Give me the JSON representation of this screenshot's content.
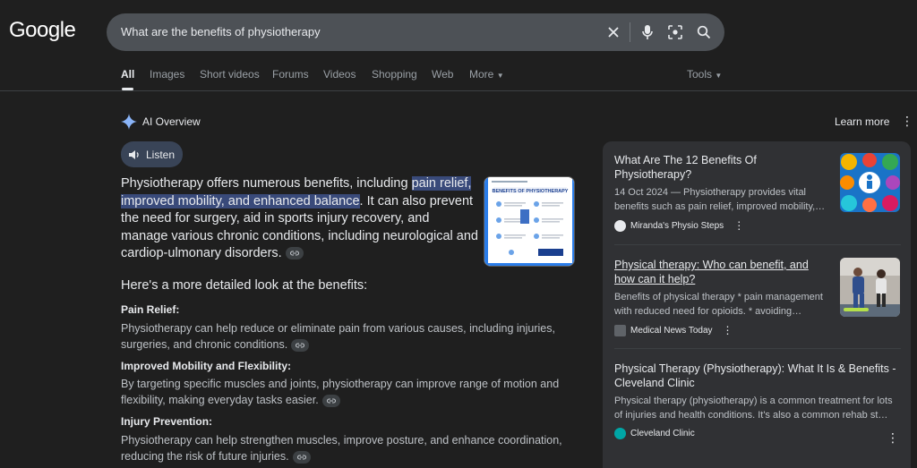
{
  "logo": "Google",
  "search": {
    "query": "What are the benefits of physiotherapy"
  },
  "tabs": [
    "All",
    "Images",
    "Short videos",
    "Forums",
    "Videos",
    "Shopping",
    "Web",
    "More"
  ],
  "tools_label": "Tools",
  "ai_overview": {
    "title": "AI Overview",
    "learn_more": "Learn more",
    "listen": "Listen",
    "lead_pre": "Physiotherapy offers numerous benefits, including ",
    "lead_hl_1": "pain relief,",
    "lead_hl_2": "improved mobility, and enhanced balance",
    "lead_post_1": ". It can also prevent",
    "lead_post_2": "the need for surgery, aid in sports injury recovery, and manage various chronic conditions, including neurological and cardiop-ulmonary disorders.",
    "subheading": "Here's a more detailed look at the benefits:",
    "thumb_title": "BENEFITS OF PHYSIOTHERAPY",
    "benefits": [
      {
        "heading": "Pain Relief:",
        "text": "Physiotherapy can help reduce or eliminate pain from various causes, including injuries, surgeries, and chronic conditions."
      },
      {
        "heading": "Improved Mobility and Flexibility:",
        "text": "By targeting specific muscles and joints, physiotherapy can improve range of motion and flexibility, making everyday tasks easier."
      },
      {
        "heading": "Injury Prevention:",
        "text": "Physiotherapy can help strengthen muscles, improve posture, and enhance coordination, reducing the risk of future injuries."
      }
    ]
  },
  "sources": [
    {
      "title": "What Are The 12 Benefits Of Physiotherapy?",
      "snippet": "14 Oct 2024 — Physiotherapy provides vital benefits such as pain relief, improved mobility,…",
      "site": "Miranda's Physio Steps"
    },
    {
      "title": "Physical therapy: Who can benefit, and how can it help?",
      "snippet": "Benefits of physical therapy * pain management with reduced need for opioids. * avoiding…",
      "site": "Medical News Today"
    },
    {
      "title": "Physical Therapy (Physiotherapy): What It Is & Benefits - Cleveland Clinic",
      "snippet": "Physical therapy (physiotherapy) is a common treatment for lots of injuries and health conditions. It's also a common rehab st…",
      "site": "Cleveland Clinic"
    }
  ],
  "colors": {
    "background": "#1f1f1f",
    "highlight": "#394a7a",
    "panel": "#303134",
    "listen_bg": "#394457"
  }
}
